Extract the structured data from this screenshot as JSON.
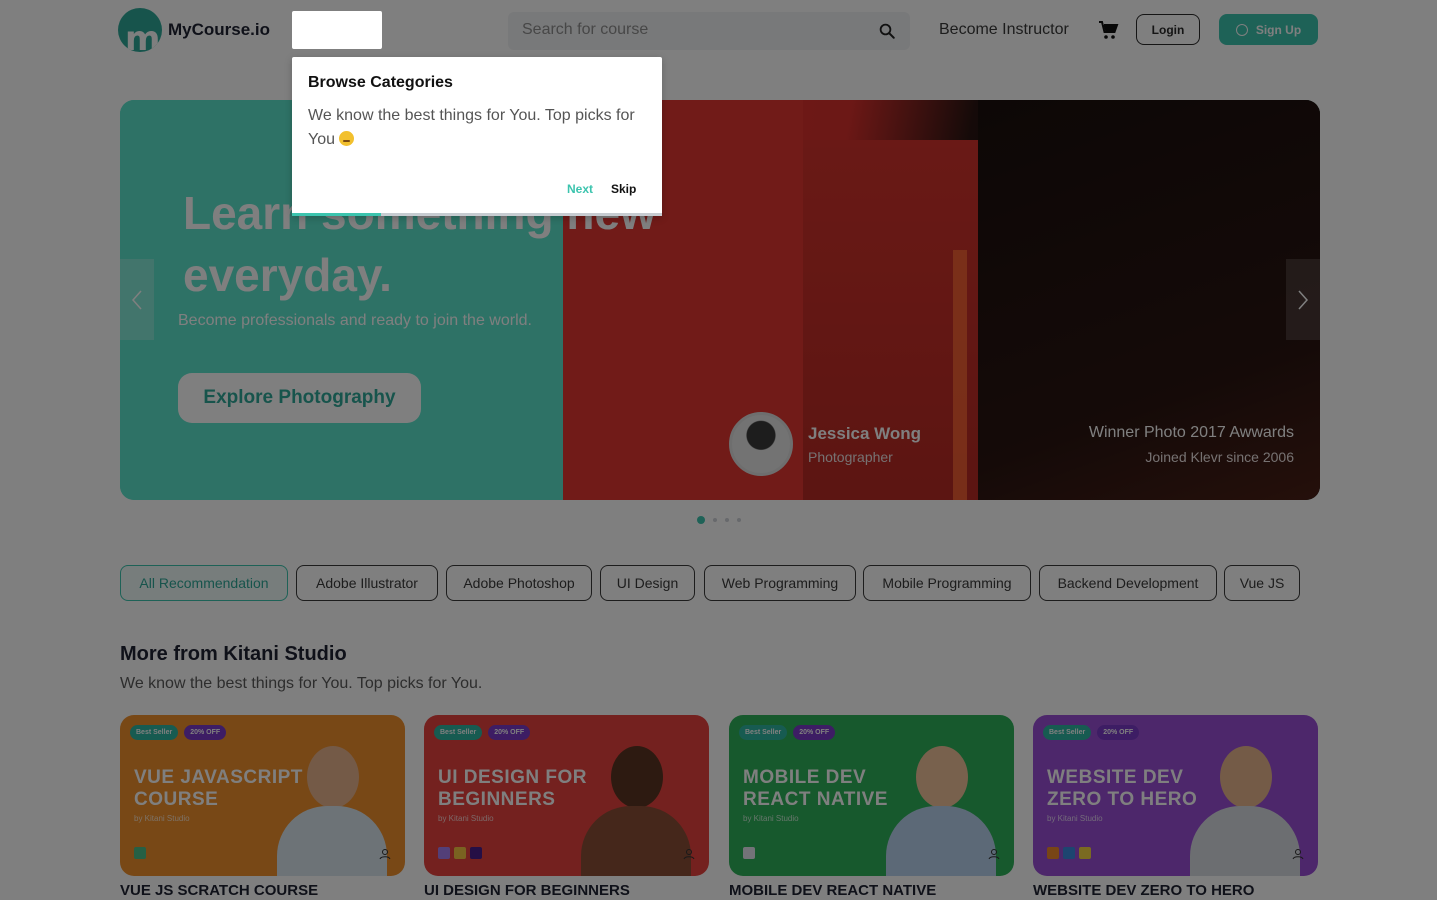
{
  "app": {
    "logo_text": "MyCourse.io",
    "logo_letter": "m"
  },
  "header": {
    "search_placeholder": "Search for course",
    "become_instructor": "Become Instructor",
    "login_label": "Login",
    "signup_label": "Sign Up"
  },
  "hero": {
    "title": "Learn something new everyday.",
    "subtitle": "Become professionals and ready to join the world.",
    "cta_label": "Explore Photography",
    "person_name": "Jessica Wong",
    "person_role": "Photographer",
    "award": "Winner Photo 2017 Awwards",
    "joined": "Joined Klevr since 2006",
    "slide_count": 4,
    "active_slide": 1
  },
  "chips": [
    {
      "label": "All Recommendation",
      "active": true
    },
    {
      "label": "Adobe Illustrator",
      "active": false
    },
    {
      "label": "Adobe Photoshop",
      "active": false
    },
    {
      "label": "UI Design",
      "active": false
    },
    {
      "label": "Web Programming",
      "active": false
    },
    {
      "label": "Mobile Programming",
      "active": false
    },
    {
      "label": "Backend Development",
      "active": false
    },
    {
      "label": "Vue JS",
      "active": false
    }
  ],
  "section": {
    "title": "More from Kitani Studio",
    "subtitle": "We know the best things for You.  Top picks for You."
  },
  "courses": [
    {
      "badge_best": "Best Seller",
      "badge_off": "20% OFF",
      "card_title": "VUE JAVASCRIPT COURSE",
      "by": "by Kitani Studio",
      "caption": "VUE JS SCRATCH COURSE",
      "color": "#f0902c"
    },
    {
      "badge_best": "Best Seller",
      "badge_off": "20% OFF",
      "card_title": "UI DESIGN FOR BEGINNERS",
      "by": "by Kitani Studio",
      "caption": "UI DESIGN FOR BEGINNERS",
      "color": "#e8423e"
    },
    {
      "badge_best": "Best Seller",
      "badge_off": "20% OFF",
      "card_title": "MOBILE DEV REACT NATIVE",
      "by": "by Kitani Studio",
      "caption": "MOBILE DEV REACT NATIVE",
      "color": "#2fb25a"
    },
    {
      "badge_best": "Best Seller",
      "badge_off": "20% OFF",
      "card_title": "WEBSITE DEV ZERO TO HERO",
      "by": "by Kitani Studio",
      "caption": "WEBSITE DEV ZERO TO HERO",
      "color": "#9a4fd6"
    }
  ],
  "tour": {
    "title": "Browse Categories",
    "body": "We know the best things for You.  Top picks for You",
    "next_label": "Next",
    "skip_label": "Skip",
    "progress": 0.24
  },
  "colors": {
    "accent": "#3cc4ae",
    "overlay": "rgba(0,0,0,0.5)"
  }
}
